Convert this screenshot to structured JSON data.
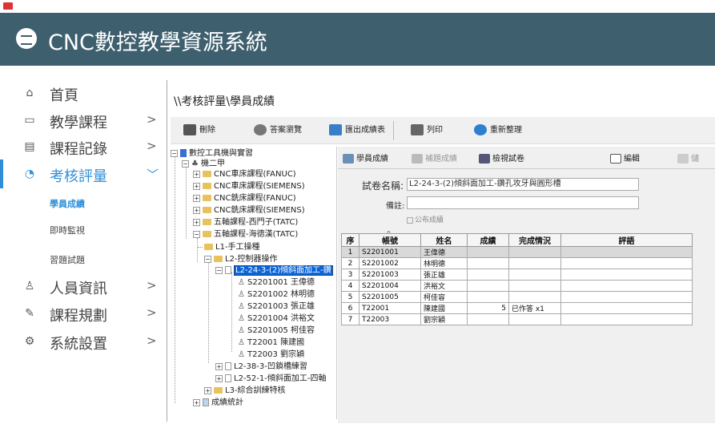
{
  "header": {
    "title": "CNC數控教學資源系統"
  },
  "sidebar": {
    "items": [
      {
        "label": "首頁",
        "icon": "home-icon",
        "glyph": "⌂"
      },
      {
        "label": "教學課程",
        "icon": "book-icon",
        "glyph": "▭",
        "chev": ">"
      },
      {
        "label": "課程記錄",
        "icon": "document-icon",
        "glyph": "▤",
        "chev": ">"
      },
      {
        "label": "考核評量",
        "icon": "chart-pie-icon",
        "glyph": "◔",
        "chev": "﹀"
      },
      {
        "label": "人員資訊",
        "icon": "user-icon",
        "glyph": "♙",
        "chev": ">"
      },
      {
        "label": "課程規劃",
        "icon": "pencil-icon",
        "glyph": "✎",
        "chev": ">"
      },
      {
        "label": "系統設置",
        "icon": "gear-icon",
        "glyph": "⚙",
        "chev": ">"
      }
    ],
    "subitems": [
      "學員成績",
      "即時監視",
      "習題試題"
    ]
  },
  "breadcrumb": "\\\\考核評量\\學員成績",
  "toolbar": {
    "delete": "刪除",
    "review": "答案瀏覽",
    "export": "匯出成績表",
    "print": "列印",
    "reorganize": "重新整理"
  },
  "tree": {
    "root": "數控工具機與實習",
    "class": "機二甲",
    "courses": [
      "CNC車床課程(FANUC)",
      "CNC車床課程(SIEMENS)",
      "CNC銑床課程(FANUC)",
      "CNC銑床課程(SIEMENS)",
      "五軸課程-西門子(TATC)",
      "五軸課程-海德漢(TATC)"
    ],
    "levels": [
      "L1-手工操種",
      "L2-控制器操作",
      "L3-綜合訓練特核"
    ],
    "exam_selected": "L2-24-3-(2)傾斜面加工-鑽",
    "students": [
      "S2201001 王偉德",
      "S2201002 林明德",
      "S2201003 張正雄",
      "S2201004 洪裕文",
      "S2201005 柯佳容",
      "T22001 陳建國",
      "T22003 劉宗穎"
    ],
    "exam_other1": "L2-38-3-凹鎖槽練習",
    "exam_other2": "L2-52-1-傾斜面加工-四軸",
    "stats": "成績統計"
  },
  "subtoolbar": {
    "student_score": "學員成績",
    "grade_score": "補題成績",
    "review_exam": "檢視試卷",
    "edit": "編輯",
    "save": "儲"
  },
  "form": {
    "exam_name_label": "試卷名稱:",
    "exam_name_value": "L2-24-3-(2)傾斜面加工-鑽孔攻牙與圓形槽",
    "note_label": "備註:",
    "publish_label": "公布成績"
  },
  "grid": {
    "headers": [
      "序",
      "帳號",
      "姓名",
      "成績",
      "完成情況",
      "評語"
    ],
    "sort_mark": "^",
    "rows": [
      {
        "no": "1",
        "account": "S2201001",
        "name": "王偉德",
        "score": "",
        "status": "",
        "comment": ""
      },
      {
        "no": "2",
        "account": "S2201002",
        "name": "林明德",
        "score": "",
        "status": "",
        "comment": ""
      },
      {
        "no": "3",
        "account": "S2201003",
        "name": "張正雄",
        "score": "",
        "status": "",
        "comment": ""
      },
      {
        "no": "4",
        "account": "S2201004",
        "name": "洪裕文",
        "score": "",
        "status": "",
        "comment": ""
      },
      {
        "no": "5",
        "account": "S2201005",
        "name": "柯佳容",
        "score": "",
        "status": "",
        "comment": ""
      },
      {
        "no": "6",
        "account": "T22001",
        "name": "陳建國",
        "score": "5",
        "status": "已作答 x1",
        "comment": ""
      },
      {
        "no": "7",
        "account": "T22003",
        "name": "劉宗穎",
        "score": "",
        "status": "",
        "comment": ""
      }
    ]
  },
  "colors": {
    "header_bg": "#3e5f6e",
    "accent": "#2e8fd8",
    "selection": "#0a64d8"
  }
}
